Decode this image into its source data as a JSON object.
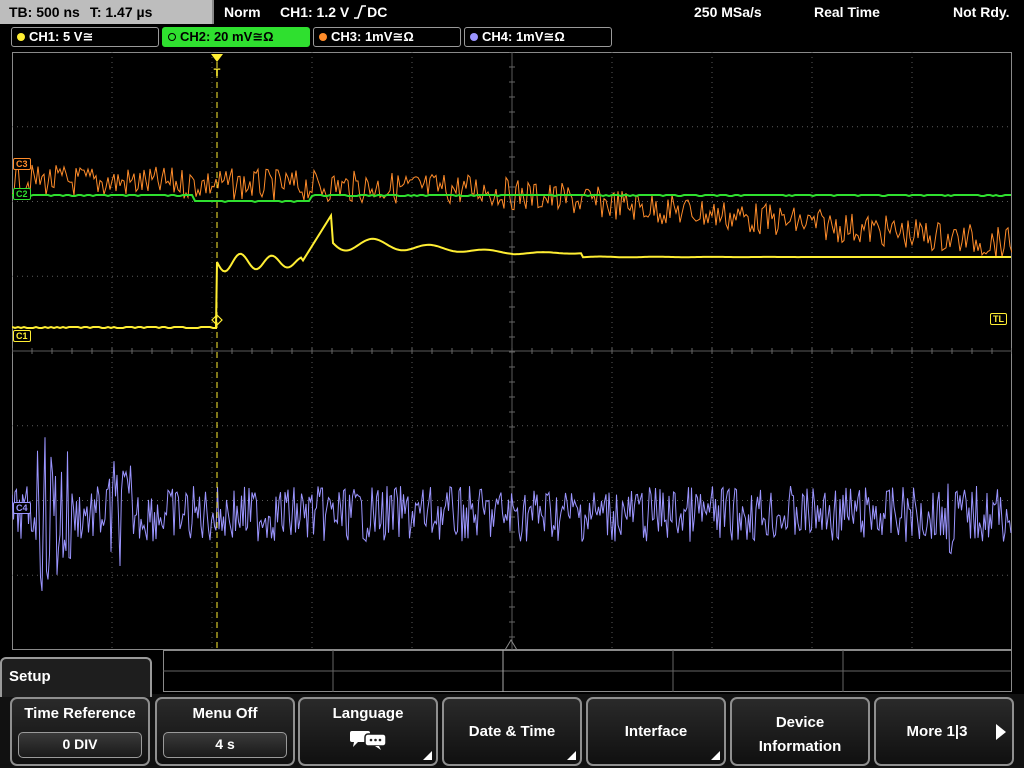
{
  "status": {
    "timebase": "TB: 500 ns",
    "trigger_time": "T: 1.47 µs",
    "trigger_mode": "Norm",
    "trigger_source": "CH1: 1.2 V",
    "trigger_coupling": "DC",
    "sample_rate": "250 MSa/s",
    "acquisition_mode": "Real Time",
    "ready_state": "Not Rdy."
  },
  "channels": [
    {
      "label": "CH1: 5 V",
      "suffix": "≅",
      "color": "#ffee33"
    },
    {
      "label": "CH2: 20 mV",
      "suffix": "≅Ω",
      "color": "#2fe02f"
    },
    {
      "label": "CH3: 1mV",
      "suffix": "≅Ω",
      "color": "#ff8c2a"
    },
    {
      "label": "CH4: 1mV",
      "suffix": "≅Ω",
      "color": "#9b95ff"
    }
  ],
  "markers": {
    "ch1": "C1",
    "ch2": "C2",
    "ch3": "C3",
    "ch4": "C4",
    "trigger_level": "TL",
    "trigger_pos": "T"
  },
  "menu": {
    "title": "Setup",
    "softkeys": [
      {
        "label": "Time Reference",
        "value": "0 DIV"
      },
      {
        "label": "Menu Off",
        "value": "4 s"
      },
      {
        "label": "Language"
      },
      {
        "label": "Date & Time"
      },
      {
        "label": "Interface"
      },
      {
        "label": "Device",
        "label2": "Information"
      },
      {
        "label": "More 1|3"
      }
    ]
  },
  "colors": {
    "ch1": "#ffee33",
    "ch2": "#2fe02f",
    "ch3": "#ff8c2a",
    "ch4": "#9b95ff",
    "grid": "#5a5a5a"
  }
}
